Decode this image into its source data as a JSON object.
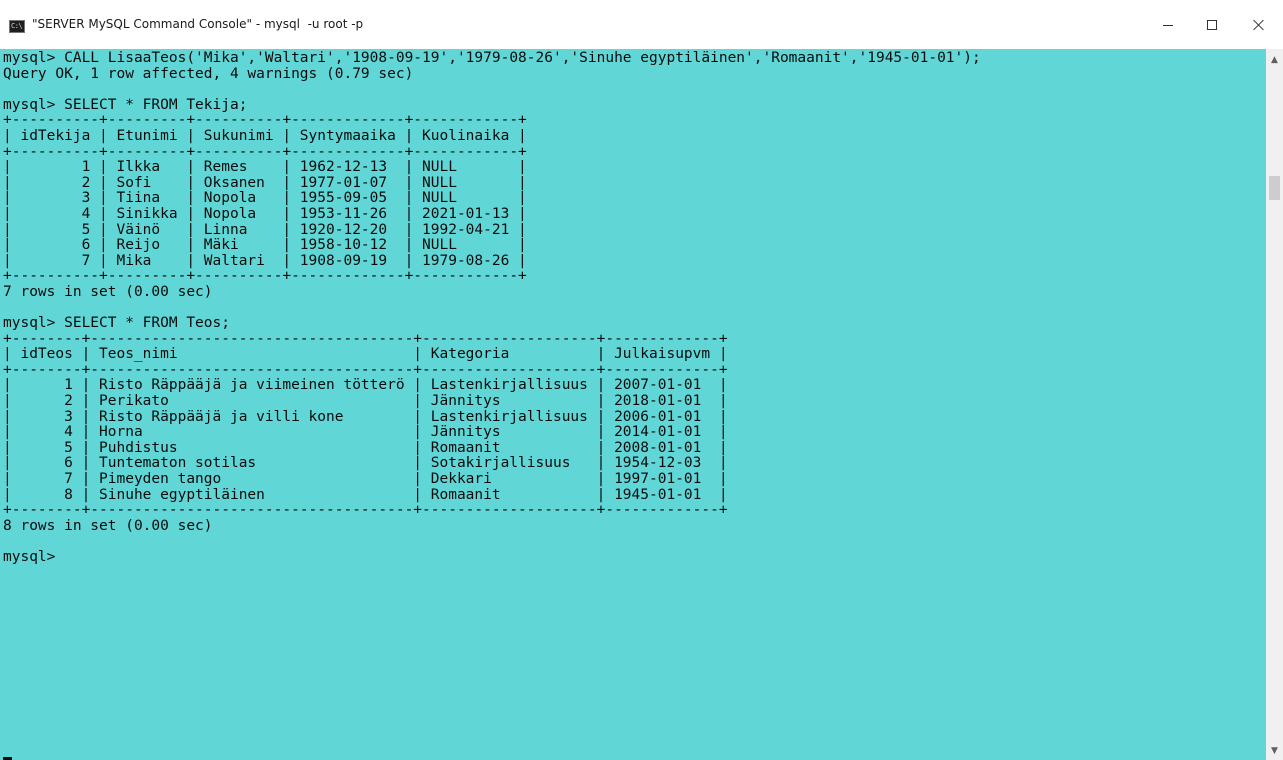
{
  "window": {
    "title": "\"SERVER MySQL Command Console\" - mysql  -u root -p",
    "icon_text": "C:\\"
  },
  "console": {
    "background": "#61d6d6",
    "foreground": "#0c0c0c",
    "lines": [
      "mysql> CALL LisaaTeos('Mika','Waltari','1908-09-19','1979-08-26','Sinuhe egyptiläinen','Romaanit','1945-01-01');",
      "Query OK, 1 row affected, 4 warnings (0.79 sec)",
      "",
      "mysql> SELECT * FROM Tekija;",
      "+----------+---------+----------+-------------+------------+",
      "| idTekija | Etunimi | Sukunimi | Syntymaaika | Kuolinaika |",
      "+----------+---------+----------+-------------+------------+",
      "|        1 | Ilkka   | Remes    | 1962-12-13  | NULL       |",
      "|        2 | Sofi    | Oksanen  | 1977-01-07  | NULL       |",
      "|        3 | Tiina   | Nopola   | 1955-09-05  | NULL       |",
      "|        4 | Sinikka | Nopola   | 1953-11-26  | 2021-01-13 |",
      "|        5 | Väinö   | Linna    | 1920-12-20  | 1992-04-21 |",
      "|        6 | Reijo   | Mäki     | 1958-10-12  | NULL       |",
      "|        7 | Mika    | Waltari  | 1908-09-19  | 1979-08-26 |",
      "+----------+---------+----------+-------------+------------+",
      "7 rows in set (0.00 sec)",
      "",
      "mysql> SELECT * FROM Teos;",
      "+--------+-------------------------------------+--------------------+-------------+",
      "| idTeos | Teos_nimi                           | Kategoria          | Julkaisupvm |",
      "+--------+-------------------------------------+--------------------+-------------+",
      "|      1 | Risto Räppääjä ja viimeinen tötterö | Lastenkirjallisuus | 2007-01-01  |",
      "|      2 | Perikato                            | Jännitys           | 2018-01-01  |",
      "|      3 | Risto Räppääjä ja villi kone        | Lastenkirjallisuus | 2006-01-01  |",
      "|      4 | Horna                               | Jännitys           | 2014-01-01  |",
      "|      5 | Puhdistus                           | Romaanit           | 2008-01-01  |",
      "|      6 | Tuntematon sotilas                  | Sotakirjallisuus   | 1954-12-03  |",
      "|      7 | Pimeyden tango                      | Dekkari            | 1997-01-01  |",
      "|      8 | Sinuhe egyptiläinen                 | Romaanit           | 1945-01-01  |",
      "+--------+-------------------------------------+--------------------+-------------+",
      "8 rows in set (0.00 sec)",
      "",
      "mysql>"
    ]
  }
}
